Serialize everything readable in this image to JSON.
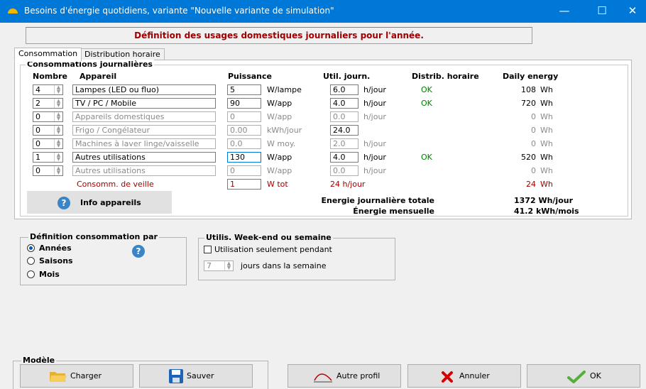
{
  "window": {
    "title": "Besoins d'énergie quotidiens, variante \"Nouvelle variante de simulation\"",
    "minimize": "—",
    "maximize": "☐",
    "close": "✕"
  },
  "banner": "Définition des usages domestiques journaliers pour l'année.",
  "tabs": [
    "Consommation",
    "Distribution horaire"
  ],
  "daily_group_title": "Consommations journalières",
  "columns": {
    "count": "Nombre",
    "device": "Appareil",
    "power": "Puissance",
    "usage": "Util. journ.",
    "distrib": "Distrib. horaire",
    "energy": "Daily energy"
  },
  "rows": [
    {
      "count": "4",
      "device": "Lampes (LED ou fluo)",
      "power": "5",
      "power_unit": "W/lampe",
      "usage": "6.0",
      "usage_unit": "h/jour",
      "distrib": "OK",
      "energy": "108",
      "energy_unit": "Wh"
    },
    {
      "count": "2",
      "device": "TV / PC / Mobile",
      "power": "90",
      "power_unit": "W/app",
      "usage": "4.0",
      "usage_unit": "h/jour",
      "distrib": "OK",
      "energy": "720",
      "energy_unit": "Wh"
    },
    {
      "count": "0",
      "device": "Appareils domestiques",
      "power": "0",
      "power_unit": "W/app",
      "usage": "0.0",
      "usage_unit": "h/jour",
      "distrib": "",
      "energy": "0",
      "energy_unit": "Wh"
    },
    {
      "count": "0",
      "device": "Frigo / Congélateur",
      "power": "0.00",
      "power_unit": "kWh/jour",
      "usage": "24.0",
      "usage_unit": "",
      "distrib": "",
      "energy": "0",
      "energy_unit": "Wh"
    },
    {
      "count": "0",
      "device": "Machines à laver linge/vaisselle",
      "power": "0.0",
      "power_unit": "W moy.",
      "usage": "2.0",
      "usage_unit": "h/jour",
      "distrib": "",
      "energy": "0",
      "energy_unit": "Wh"
    },
    {
      "count": "1",
      "device": "Autres utilisations",
      "power": "130",
      "power_unit": "W/app",
      "usage": "4.0",
      "usage_unit": "h/jour",
      "distrib": "OK",
      "energy": "520",
      "energy_unit": "Wh"
    },
    {
      "count": "0",
      "device": "Autres utilisations",
      "power": "0",
      "power_unit": "W/app",
      "usage": "0.0",
      "usage_unit": "h/jour",
      "distrib": "",
      "energy": "0",
      "energy_unit": "Wh"
    }
  ],
  "standby": {
    "label": "Consomm. de veille",
    "power": "1",
    "power_unit": "W tot",
    "usage": "24 h/jour",
    "energy": "24",
    "energy_unit": "Wh"
  },
  "totals": {
    "daily_label": "Energie journalière totale",
    "daily_value": "1372 Wh/jour",
    "monthly_label": "Énergie mensuelle",
    "monthly_value": "41.2 kWh/mois"
  },
  "info_button": "Info appareils",
  "definition": {
    "title": "Définition consommation par",
    "options": [
      "Années",
      "Saisons",
      "Mois"
    ],
    "selected": "Années"
  },
  "weekend": {
    "title": "Utilis. Week-end ou semaine",
    "checkbox_label": "Utilisation seulement pendant",
    "days_value": "7",
    "days_label": "jours dans la semaine"
  },
  "model": {
    "title": "Modèle",
    "load": "Charger",
    "save": "Sauver"
  },
  "buttons": {
    "other_profile": "Autre profil",
    "cancel": "Annuler",
    "ok": "OK"
  },
  "colors": {
    "titlebar": "#0078d7",
    "banner_text": "#a00000",
    "ok_text": "#008000"
  }
}
